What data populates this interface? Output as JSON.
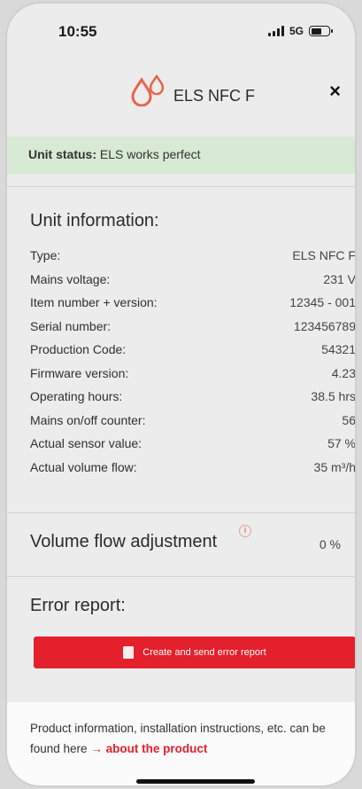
{
  "statusbar": {
    "time": "10:55",
    "network": "5G"
  },
  "header": {
    "title": "ELS NFC F",
    "close_label": "×"
  },
  "unit_status": {
    "label": "Unit status:",
    "value": "ELS works perfect"
  },
  "unit_info": {
    "title": "Unit information:",
    "rows": [
      {
        "label": "Type:",
        "value": "ELS NFC F"
      },
      {
        "label": "Mains voltage:",
        "value": "231 V"
      },
      {
        "label": "Item number + version:",
        "value": "12345 - 001"
      },
      {
        "label": "Serial number:",
        "value": "123456789"
      },
      {
        "label": "Production Code:",
        "value": "54321"
      },
      {
        "label": "Firmware version:",
        "value": "4.23"
      },
      {
        "label": "Operating hours:",
        "value": "38.5 hrs"
      },
      {
        "label": "Mains on/off counter:",
        "value": "56"
      },
      {
        "label": "Actual sensor value:",
        "value": "57 %"
      },
      {
        "label": "Actual volume flow:",
        "value": "35 m³/h"
      }
    ]
  },
  "volume_flow": {
    "title": "Volume flow adjustment",
    "value": "0 %"
  },
  "error_report": {
    "title": "Error report:",
    "button_label": "Create and send error report"
  },
  "footer": {
    "text": "Product information, installation instructions, etc. can be found here",
    "arrow": "→",
    "link": "about the product"
  },
  "colors": {
    "accent": "#e3202b",
    "status_bg": "#d7ead3",
    "logo": "#e8654a"
  },
  "icons": {
    "logo": "water-drops-icon",
    "close": "close-icon",
    "info": "info-icon",
    "document": "document-icon"
  }
}
